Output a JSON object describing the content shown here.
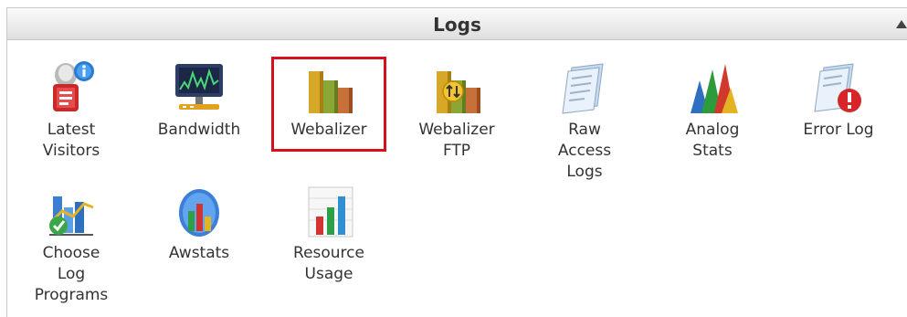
{
  "panel": {
    "title": "Logs",
    "collapse_icon": "triangle-up-icon"
  },
  "items": [
    {
      "label": "Latest\nVisitors",
      "icon": "latest-visitors-icon"
    },
    {
      "label": "Bandwidth",
      "icon": "bandwidth-icon"
    },
    {
      "label": "Webalizer",
      "icon": "webalizer-icon"
    },
    {
      "label": "Webalizer\nFTP",
      "icon": "webalizer-ftp-icon"
    },
    {
      "label": "Raw\nAccess\nLogs",
      "icon": "raw-access-logs-icon"
    },
    {
      "label": "Analog\nStats",
      "icon": "analog-stats-icon"
    },
    {
      "label": "Error Log",
      "icon": "error-log-icon"
    },
    {
      "label": "Choose\nLog\nPrograms",
      "icon": "choose-log-programs-icon"
    },
    {
      "label": "Awstats",
      "icon": "awstats-icon"
    },
    {
      "label": "Resource\nUsage",
      "icon": "resource-usage-icon"
    }
  ],
  "highlighted_item": "Webalizer",
  "colors": {
    "highlight_border": "#d3121e",
    "label_text": "#333333"
  }
}
